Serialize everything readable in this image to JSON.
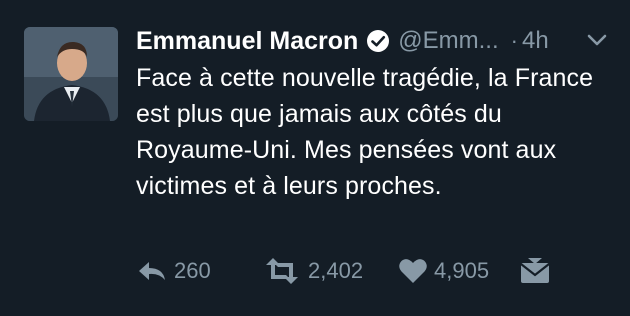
{
  "tweet": {
    "author": {
      "display_name": "Emmanuel Macron",
      "handle": "@Emm...",
      "verified": true
    },
    "separator": "·",
    "time": "4h",
    "text": "Face à cette nouvelle tragédie, la France est plus que jamais aux côtés du Royaume-Uni. Mes pensées vont aux victimes et à leurs proches.",
    "actions": {
      "reply_count": "260",
      "retweet_count": "2,402",
      "like_count": "4,905"
    },
    "icons": [
      "verified-badge-icon",
      "chevron-down-icon",
      "reply-icon",
      "retweet-icon",
      "heart-icon",
      "direct-message-icon"
    ],
    "colors": {
      "background": "#141d26",
      "text": "#ffffff",
      "muted": "#8899a6"
    }
  }
}
